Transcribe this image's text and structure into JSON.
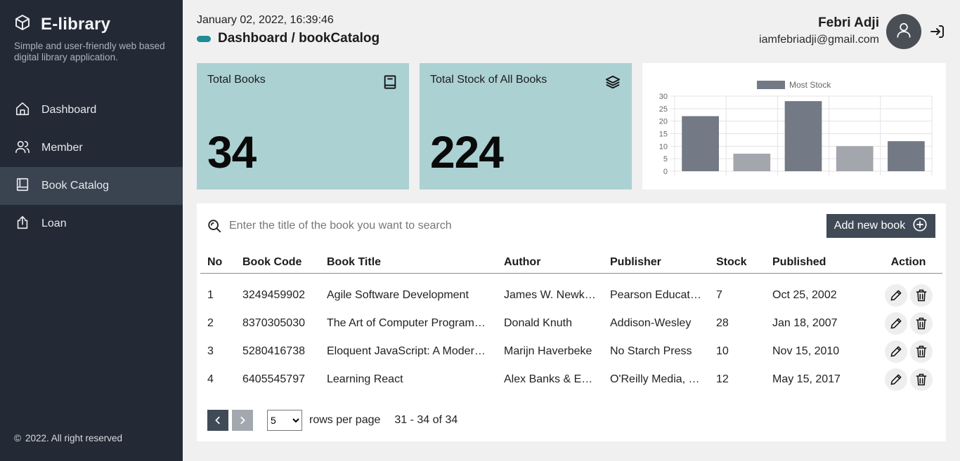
{
  "app": {
    "title": "E-library",
    "tagline": "Simple and user-friendly web based digital library application.",
    "footer": "2022. All right reserved",
    "footer_symbol": "©"
  },
  "nav": {
    "items": [
      {
        "label": "Dashboard",
        "icon": "home-icon",
        "active": false
      },
      {
        "label": "Member",
        "icon": "users-icon",
        "active": false
      },
      {
        "label": "Book Catalog",
        "icon": "book-icon",
        "active": true
      },
      {
        "label": "Loan",
        "icon": "upload-icon",
        "active": false
      }
    ]
  },
  "header": {
    "datetime": "January 02, 2022, 16:39:46",
    "breadcrumb": "Dashboard / bookCatalog",
    "user_name": "Febri Adji",
    "user_email": "iamfebriadji@gmail.com"
  },
  "stats": {
    "total_books_label": "Total Books",
    "total_books_value": "34",
    "total_stock_label": "Total Stock of All Books",
    "total_stock_value": "224"
  },
  "chart_data": {
    "type": "bar",
    "categories": [
      "",
      "",
      "",
      "",
      ""
    ],
    "series": [
      {
        "name": "Most Stock",
        "values": [
          22,
          7,
          28,
          10,
          12
        ]
      }
    ],
    "ylim": [
      0,
      30
    ],
    "yticks": [
      0,
      5,
      10,
      15,
      20,
      25,
      30
    ],
    "legend": "top-center",
    "grid": true,
    "colors": [
      "#737985",
      "#a3a6ad",
      "#737985",
      "#a3a6ad",
      "#737985"
    ]
  },
  "search": {
    "placeholder": "Enter the title of the book you want to search",
    "value": ""
  },
  "add_button": {
    "label": "Add new book"
  },
  "table": {
    "headers": {
      "no": "No",
      "code": "Book Code",
      "title": "Book Title",
      "author": "Author",
      "publisher": "Publisher",
      "stock": "Stock",
      "published": "Published",
      "action": "Action"
    },
    "rows": [
      {
        "no": "1",
        "code": "3249459902",
        "title": "Agile Software Development",
        "author": "James W. Newkirk",
        "publisher": "Pearson Educati…",
        "stock": "7",
        "published": "Oct 25, 2002"
      },
      {
        "no": "2",
        "code": "8370305030",
        "title": "The Art of Computer Program…",
        "author": "Donald Knuth",
        "publisher": "Addison-Wesley",
        "stock": "28",
        "published": "Jan 18, 2007"
      },
      {
        "no": "3",
        "code": "5280416738",
        "title": "Eloquent JavaScript: A Modern…",
        "author": "Marijn Haverbeke",
        "publisher": "No Starch Press",
        "stock": "10",
        "published": "Nov 15, 2010"
      },
      {
        "no": "4",
        "code": "6405545797",
        "title": "Learning React",
        "author": "Alex Banks & Ev…",
        "publisher": "O'Reilly Media, I…",
        "stock": "12",
        "published": "May 15, 2017"
      }
    ]
  },
  "pagination": {
    "rows_per_page_value": "5",
    "rows_per_page_label": "rows per page",
    "range": "31 - 34 of 34"
  },
  "colors": {
    "sidebar_bg": "#232a35",
    "sidebar_active": "#3a4350",
    "card_bg": "#abd1d3",
    "accent": "#218c95",
    "button_bg": "#404a57"
  }
}
